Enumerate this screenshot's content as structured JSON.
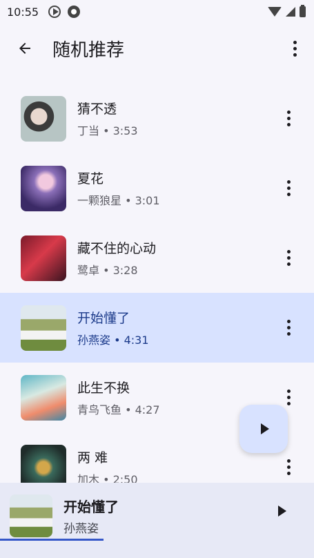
{
  "status_bar": {
    "time": "10:55"
  },
  "app_bar": {
    "title": "随机推荐"
  },
  "songs": [
    {
      "title": "猜不透",
      "artist": "丁当",
      "duration": "3:53",
      "meta": "丁当 • 3:53"
    },
    {
      "title": "夏花",
      "artist": "一颗狼星",
      "duration": "3:01",
      "meta": "一颗狼星 • 3:01"
    },
    {
      "title": "藏不住的心动",
      "artist": "鹭卓",
      "duration": "3:28",
      "meta": "鹭卓 • 3:28"
    },
    {
      "title": "开始懂了",
      "artist": "孙燕姿",
      "duration": "4:31",
      "meta": "孙燕姿 • 4:31",
      "active": true
    },
    {
      "title": "此生不换",
      "artist": "青鸟飞鱼",
      "duration": "4:27",
      "meta": "青鸟飞鱼 • 4:27"
    },
    {
      "title": "两 难",
      "artist": "加木",
      "duration": "2:50",
      "meta": "加木 • 2:50"
    }
  ],
  "now_playing": {
    "title": "开始懂了",
    "artist": "孙燕姿",
    "progress": 0.33
  },
  "colors": {
    "active_row": "#d8e2ff",
    "progress": "#3557c8",
    "mini_player_bg": "#e7e9f6"
  },
  "icons": [
    "play-circle-icon",
    "record-icon",
    "wifi-icon",
    "signal-icon",
    "battery-icon",
    "back-arrow-icon",
    "more-vert-icon",
    "play-icon"
  ]
}
